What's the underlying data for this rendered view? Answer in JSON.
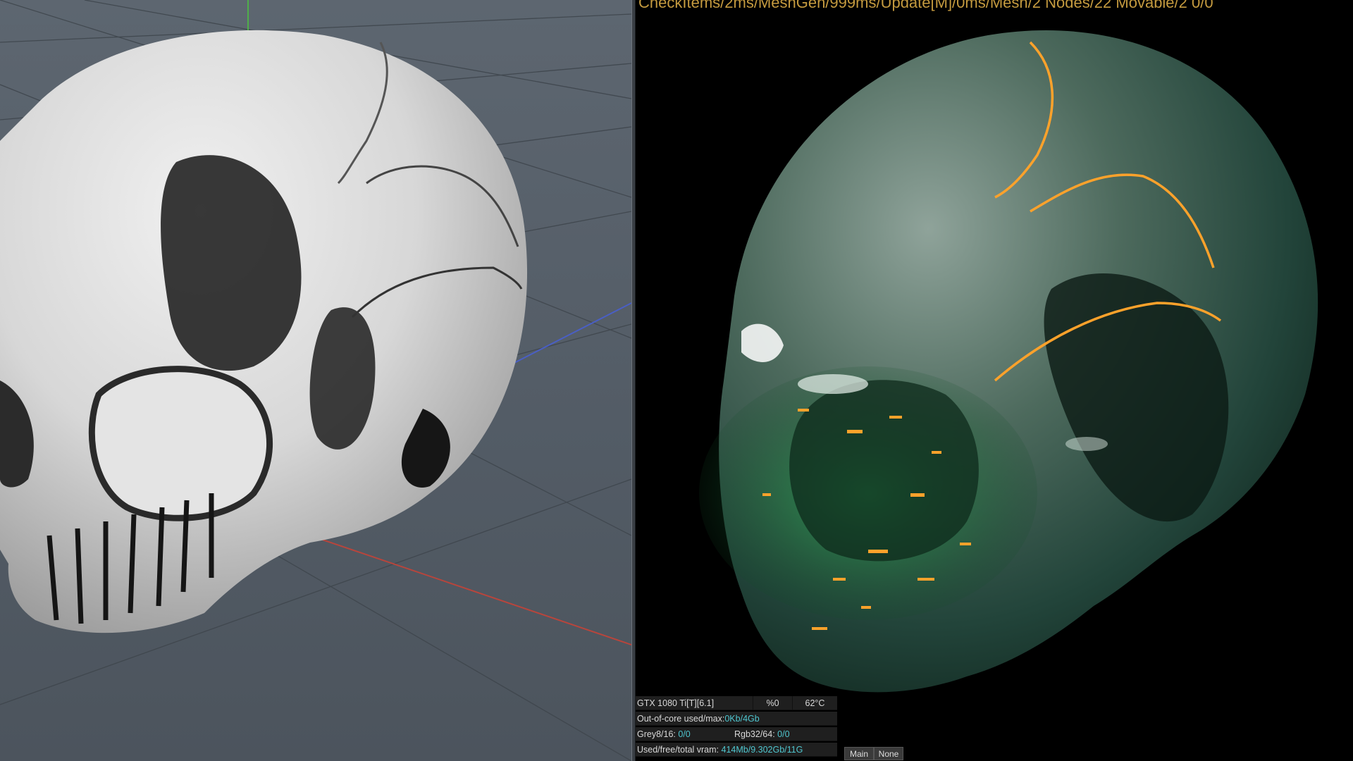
{
  "render_status": "CheckItems/2ms/MeshGen/999ms/Update[M]/0ms/Mesh/2 Nodes/22 Movable/2 0/0",
  "stats": {
    "gpu_label": "GTX 1080 Ti[T][6.1]",
    "gpu_usage": "%0",
    "gpu_temp": "62°C",
    "out_of_core_label": "Out-of-core used/max:",
    "out_of_core_value": "0Kb/4Gb",
    "grey_label": "Grey8/16:",
    "grey_value": "0/0",
    "rgb_label": "Rgb32/64:",
    "rgb_value": "0/0",
    "vram_label": "Used/free/total vram:",
    "vram_value": "414Mb/9.302Gb/11G"
  },
  "buttons": {
    "main": "Main",
    "none": "None"
  },
  "colors": {
    "viewport_bg": "#59626c",
    "grid_line": "#3f464d",
    "axis_x": "#b8453c",
    "axis_y": "#4fae4a",
    "axis_z": "#4a5fc4",
    "value_text": "#4fc6cf",
    "crack_glow": "#ffa22b",
    "jade": "#1f6b3e"
  }
}
